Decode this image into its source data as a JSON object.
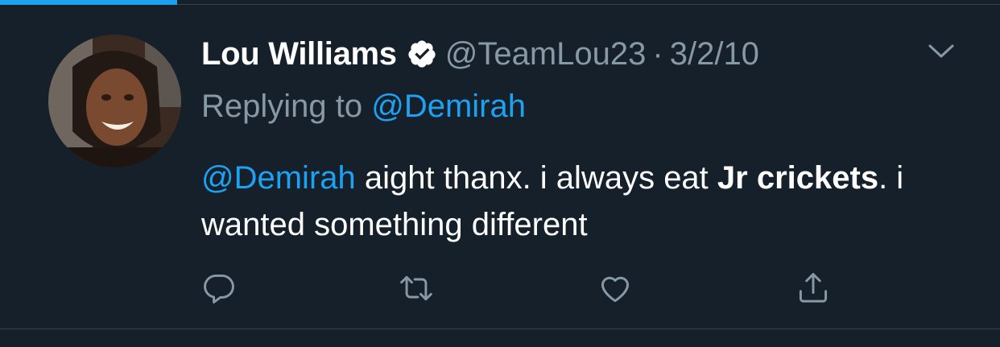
{
  "tweet": {
    "display_name": "Lou Williams",
    "handle": "@TeamLou23",
    "separator": "·",
    "date": "3/2/10",
    "reply_prefix": "Replying to ",
    "reply_to": "@Demirah",
    "body": {
      "mention": "@Demirah",
      "text_1": " aight thanx. i always eat ",
      "bold_1": "Jr crickets",
      "text_2": ". i wanted something different"
    }
  },
  "icons": {
    "verified": "verified-badge-icon",
    "caret": "chevron-down-icon",
    "reply": "reply-icon",
    "retweet": "retweet-icon",
    "like": "heart-icon",
    "share": "share-icon"
  },
  "colors": {
    "background": "#15202b",
    "accent": "#1da1f2",
    "muted": "#8899a6",
    "divider": "#38444d"
  }
}
